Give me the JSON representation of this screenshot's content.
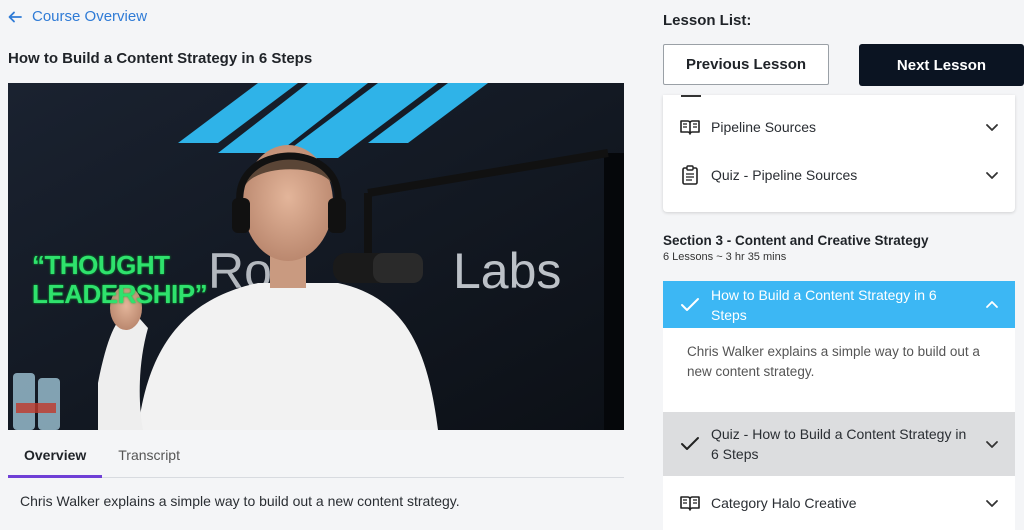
{
  "nav": {
    "back_label": "Course Overview"
  },
  "lesson": {
    "title": "How to Build a Content Strategy in 6 Steps",
    "video_overlay_line1": "“THOUGHT",
    "video_overlay_line2": "LEADERSHIP”",
    "video_brand_text": "Labs"
  },
  "tabs": [
    {
      "label": "Overview",
      "active": true
    },
    {
      "label": "Transcript",
      "active": false
    }
  ],
  "overview_text": "Chris Walker explains a simple way to build out a new content strategy.",
  "lesson_list": {
    "heading": "Lesson List:",
    "previous_label": "Previous Lesson",
    "next_label": "Next Lesson",
    "prior_items": [
      {
        "label": "Pipeline Sources",
        "icon": "book-icon"
      },
      {
        "label": "Quiz - Pipeline Sources",
        "icon": "clipboard-icon"
      }
    ],
    "section": {
      "title": "Section 3 - Content and Creative Strategy",
      "meta": "6 Lessons ~ 3 hr 35 mins"
    },
    "active_item": {
      "label": "How to Build a Content Strategy in 6 Steps",
      "description": "Chris Walker explains a simple way to build out a new content strategy."
    },
    "quiz_item": {
      "label": "Quiz - How to Build a Content Strategy in 6 Steps"
    },
    "next_item": {
      "label": "Category Halo Creative"
    }
  },
  "colors": {
    "accent_link": "#2f7bd6",
    "active_row": "#3cb7f4",
    "next_button": "#0b1422",
    "tab_underline": "#6f3fd6",
    "overlay_green": "#2fe26d"
  }
}
